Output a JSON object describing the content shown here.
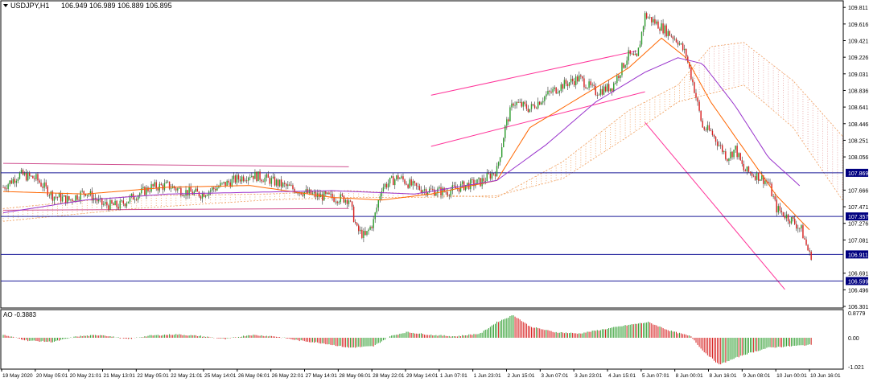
{
  "header": {
    "symbol": "USDJPY,H1",
    "ohlc": "106.949 106.989 106.889 106.895"
  },
  "indicator": {
    "label": "AO -0.3883"
  },
  "colors": {
    "bull": "#2e9d2e",
    "bear": "#d62020",
    "wick": "#333333",
    "ma_fast": "#ff6600",
    "ma_slow": "#9933cc",
    "cloud": "#f0a060",
    "cloud_future": "#e6a0a0",
    "channel": "#ff3399",
    "level_line": "#1a1a99",
    "level_badge": "#000080",
    "ao_up": "#2e9d2e",
    "ao_down": "#d62020"
  },
  "chart_data": [
    {
      "type": "line",
      "title": "",
      "series": [
        {
          "name": "USDJPY,H1",
          "values_desc": "candlesticks"
        }
      ],
      "y_ticks": [
        "109.811",
        "109.616",
        "109.421",
        "109.226",
        "109.031",
        "108.836",
        "108.641",
        "108.446",
        "108.251",
        "108.056",
        "107.666",
        "107.471",
        "107.276",
        "107.081",
        "106.691",
        "106.496",
        "106.301"
      ],
      "ylim": [
        106.301,
        109.86
      ],
      "price_levels": [
        "107.869",
        "107.357",
        "106.911",
        "106.599"
      ],
      "x_ticks": [
        "19 May 2020",
        "20 May 05:01",
        "20 May 21:01",
        "21 May 13:01",
        "22 May 05:01",
        "22 May 21:01",
        "25 May 14:01",
        "26 May 06:01",
        "26 May 22:01",
        "27 May 14:01",
        "28 May 06:01",
        "28 May 22:01",
        "29 May 14:01",
        "1 Jun 07:01",
        "1 Jun 23:01",
        "2 Jun 15:01",
        "3 Jun 07:01",
        "3 Jun 23:01",
        "4 Jun 15:01",
        "5 Jun 07:01",
        "8 Jun 00:01",
        "8 Jun 16:01",
        "9 Jun 08:01",
        "10 Jun 00:01",
        "10 Jun 16:01"
      ],
      "anchors": [
        [
          0,
          107.7
        ],
        [
          10,
          107.85
        ],
        [
          20,
          107.8
        ],
        [
          30,
          107.6
        ],
        [
          40,
          107.55
        ],
        [
          50,
          107.65
        ],
        [
          60,
          107.5
        ],
        [
          70,
          107.48
        ],
        [
          80,
          107.6
        ],
        [
          90,
          107.7
        ],
        [
          100,
          107.72
        ],
        [
          110,
          107.65
        ],
        [
          120,
          107.62
        ],
        [
          130,
          107.7
        ],
        [
          140,
          107.78
        ],
        [
          150,
          107.85
        ],
        [
          160,
          107.8
        ],
        [
          170,
          107.72
        ],
        [
          180,
          107.66
        ],
        [
          190,
          107.6
        ],
        [
          200,
          107.58
        ],
        [
          210,
          107.56
        ],
        [
          215,
          107.2
        ],
        [
          220,
          107.12
        ],
        [
          225,
          107.3
        ],
        [
          230,
          107.7
        ],
        [
          240,
          107.82
        ],
        [
          250,
          107.7
        ],
        [
          260,
          107.66
        ],
        [
          270,
          107.65
        ],
        [
          280,
          107.72
        ],
        [
          290,
          107.76
        ],
        [
          300,
          107.9
        ],
        [
          305,
          108.4
        ],
        [
          310,
          108.7
        ],
        [
          320,
          108.62
        ],
        [
          330,
          108.78
        ],
        [
          340,
          108.9
        ],
        [
          350,
          108.98
        ],
        [
          360,
          108.82
        ],
        [
          370,
          108.88
        ],
        [
          380,
          109.25
        ],
        [
          385,
          109.2
        ],
        [
          390,
          109.72
        ],
        [
          400,
          109.58
        ],
        [
          410,
          109.42
        ],
        [
          415,
          109.25
        ],
        [
          420,
          108.85
        ],
        [
          425,
          108.4
        ],
        [
          430,
          108.35
        ],
        [
          435,
          108.2
        ],
        [
          440,
          108.05
        ],
        [
          445,
          108.15
        ],
        [
          450,
          107.9
        ],
        [
          460,
          107.82
        ],
        [
          465,
          107.75
        ],
        [
          470,
          107.45
        ],
        [
          480,
          107.3
        ],
        [
          485,
          107.2
        ],
        [
          490,
          106.905
        ]
      ],
      "ma_fast": [
        [
          0,
          107.65
        ],
        [
          50,
          107.62
        ],
        [
          100,
          107.7
        ],
        [
          150,
          107.72
        ],
        [
          200,
          107.58
        ],
        [
          230,
          107.55
        ],
        [
          260,
          107.62
        ],
        [
          300,
          107.78
        ],
        [
          320,
          108.4
        ],
        [
          350,
          108.75
        ],
        [
          380,
          109.1
        ],
        [
          400,
          109.45
        ],
        [
          415,
          109.22
        ],
        [
          430,
          108.7
        ],
        [
          450,
          108.15
        ],
        [
          470,
          107.6
        ],
        [
          490,
          107.2
        ]
      ],
      "ma_slow": [
        [
          0,
          107.4
        ],
        [
          50,
          107.55
        ],
        [
          100,
          107.62
        ],
        [
          150,
          107.64
        ],
        [
          200,
          107.66
        ],
        [
          250,
          107.62
        ],
        [
          300,
          107.78
        ],
        [
          330,
          108.2
        ],
        [
          360,
          108.7
        ],
        [
          390,
          109.05
        ],
        [
          410,
          109.22
        ],
        [
          425,
          109.15
        ],
        [
          445,
          108.65
        ],
        [
          465,
          108.05
        ],
        [
          485,
          107.7
        ]
      ],
      "cloud_span_a": [
        [
          0,
          107.45
        ],
        [
          80,
          107.6
        ],
        [
          160,
          107.62
        ],
        [
          210,
          107.66
        ],
        [
          250,
          107.62
        ],
        [
          300,
          107.58
        ],
        [
          340,
          108.0
        ],
        [
          380,
          108.6
        ],
        [
          410,
          108.9
        ],
        [
          430,
          109.35
        ],
        [
          450,
          109.4
        ],
        [
          480,
          108.95
        ],
        [
          510,
          108.3
        ]
      ],
      "cloud_span_b": [
        [
          0,
          107.3
        ],
        [
          80,
          107.45
        ],
        [
          160,
          107.55
        ],
        [
          210,
          107.58
        ],
        [
          250,
          107.58
        ],
        [
          300,
          107.6
        ],
        [
          340,
          107.8
        ],
        [
          380,
          108.3
        ],
        [
          410,
          108.7
        ],
        [
          430,
          108.8
        ],
        [
          450,
          108.9
        ],
        [
          480,
          108.4
        ],
        [
          510,
          107.55
        ]
      ],
      "ao": [
        [
          0,
          0.1
        ],
        [
          15,
          -0.1
        ],
        [
          30,
          -0.15
        ],
        [
          45,
          0.05
        ],
        [
          60,
          0.1
        ],
        [
          75,
          -0.05
        ],
        [
          90,
          0.08
        ],
        [
          105,
          0.12
        ],
        [
          120,
          0.06
        ],
        [
          135,
          -0.05
        ],
        [
          150,
          0.1
        ],
        [
          165,
          0.05
        ],
        [
          180,
          -0.1
        ],
        [
          195,
          -0.2
        ],
        [
          210,
          -0.35
        ],
        [
          225,
          -0.3
        ],
        [
          235,
          0.05
        ],
        [
          245,
          0.2
        ],
        [
          260,
          0.1
        ],
        [
          275,
          0.05
        ],
        [
          290,
          0.15
        ],
        [
          300,
          0.55
        ],
        [
          310,
          0.8
        ],
        [
          320,
          0.4
        ],
        [
          335,
          0.2
        ],
        [
          350,
          0.15
        ],
        [
          365,
          0.3
        ],
        [
          380,
          0.45
        ],
        [
          392,
          0.55
        ],
        [
          405,
          0.25
        ],
        [
          418,
          0.05
        ],
        [
          425,
          -0.45
        ],
        [
          435,
          -0.95
        ],
        [
          450,
          -0.6
        ],
        [
          465,
          -0.35
        ],
        [
          478,
          -0.3
        ],
        [
          490,
          -0.25
        ]
      ]
    },
    {
      "type": "bar",
      "title": "AO -0.3883",
      "y_ticks": [
        "0.8779",
        "0.00",
        "-1.021"
      ],
      "ylim": [
        -1.021,
        0.8779
      ]
    }
  ]
}
